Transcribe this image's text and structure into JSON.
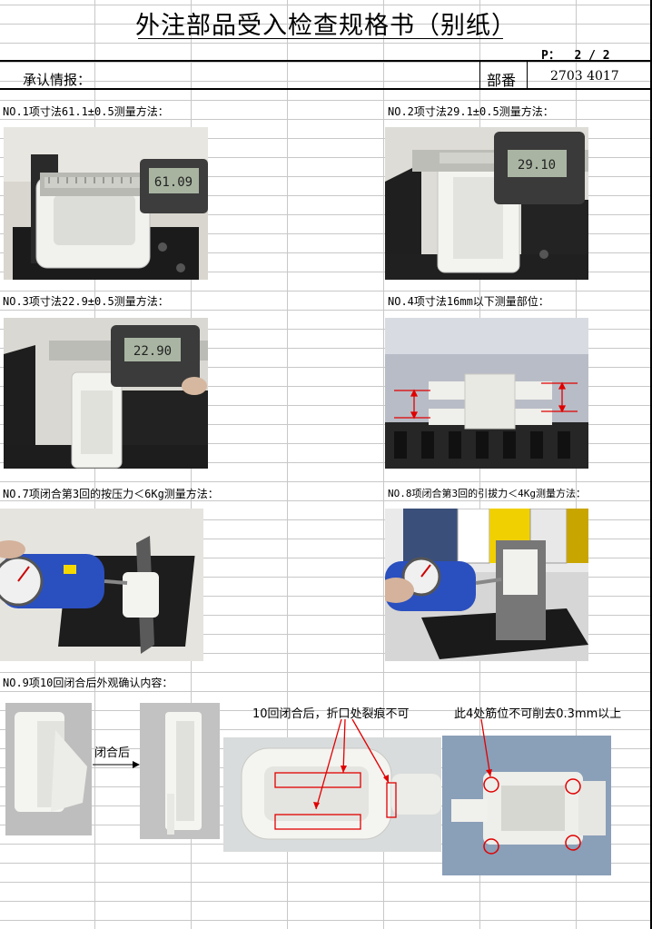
{
  "header": {
    "title": "外注部品受入检查规格书（别纸）",
    "page_label": "P：",
    "page_value": "2 / 2",
    "approval_label": "承认情报：",
    "part_label": "部番",
    "part_number": "2703 4017"
  },
  "sections": {
    "no1": "NO.1项寸法61.1±0.5测量方法：",
    "no2": "NO.2项寸法29.1±0.5测量方法：",
    "no3": "NO.3项寸法22.9±0.5测量方法：",
    "no4": "NO.4项寸法16mm以下测量部位：",
    "no7": "NO.7项闭合第3回的按压力＜6Kg测量方法：",
    "no8": "NO.8项闭合第3回的引拔力＜4Kg测量方法：",
    "no9": "NO.9项10回闭合后外观确认内容："
  },
  "annotations": {
    "after_close": "闭合后",
    "crack_note": "10回闭合后，折口处裂痕不可",
    "rib_note": "此4处筋位不可削去0.3mm以上"
  },
  "readouts": {
    "caliper1": "61.09",
    "caliper2": "29.10",
    "caliper3": "22.90"
  },
  "colors": {
    "accent_red": "#e00000",
    "gauge_blue": "#2a4fbf",
    "grid": "#c8c8c8"
  }
}
